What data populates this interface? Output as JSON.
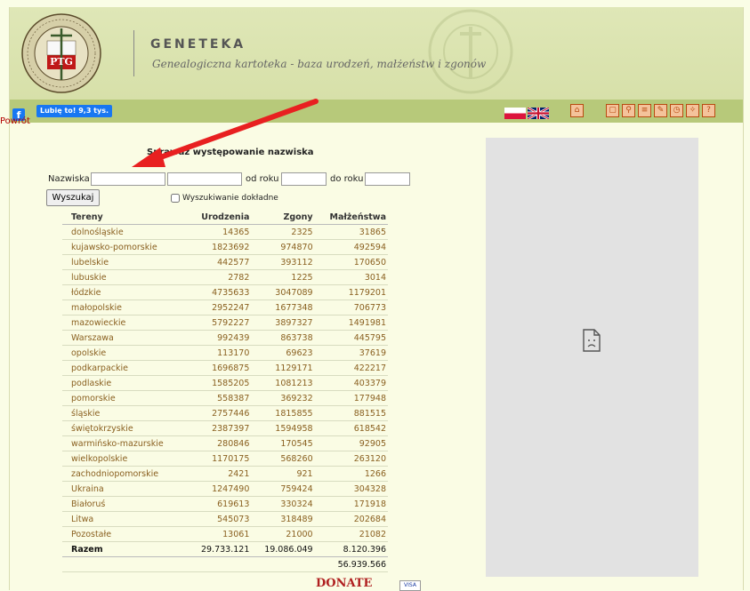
{
  "header": {
    "title": "GENETEKA",
    "subtitle": "Genealogiczna kartoteka - baza urodzeń, małżeństw i zgonów",
    "logo_text": "PTG"
  },
  "nav": {
    "fb_like_label": "Lubię to! 9,3 tys.",
    "flags": [
      "pl-flag",
      "uk-flag"
    ],
    "icons": [
      "home-icon",
      "book-icon",
      "search-icon",
      "list-icon",
      "edit-icon",
      "clock-icon",
      "tools-icon",
      "help-icon"
    ]
  },
  "back_link": "Powrót",
  "search": {
    "title": "Sprawdź występowanie nazwiska",
    "surname_label": "Nazwiska",
    "surname_value": "",
    "surname2_value": "",
    "from_label": "od roku",
    "from_value": "",
    "to_label": "do roku",
    "to_value": "",
    "button_label": "Wyszukaj",
    "exact_label": "Wyszukiwanie dokładne"
  },
  "table": {
    "headers": [
      "Tereny",
      "Urodzenia",
      "Zgony",
      "Małżeństwa"
    ],
    "rows": [
      [
        "dolnośląskie",
        "14365",
        "2325",
        "31865"
      ],
      [
        "kujawsko-pomorskie",
        "1823692",
        "974870",
        "492594"
      ],
      [
        "lubelskie",
        "442577",
        "393112",
        "170650"
      ],
      [
        "lubuskie",
        "2782",
        "1225",
        "3014"
      ],
      [
        "łódzkie",
        "4735633",
        "3047089",
        "1179201"
      ],
      [
        "małopolskie",
        "2952247",
        "1677348",
        "706773"
      ],
      [
        "mazowieckie",
        "5792227",
        "3897327",
        "1491981"
      ],
      [
        "Warszawa",
        "992439",
        "863738",
        "445795"
      ],
      [
        "opolskie",
        "113170",
        "69623",
        "37619"
      ],
      [
        "podkarpackie",
        "1696875",
        "1129171",
        "422217"
      ],
      [
        "podlaskie",
        "1585205",
        "1081213",
        "403379"
      ],
      [
        "pomorskie",
        "558387",
        "369232",
        "177948"
      ],
      [
        "śląskie",
        "2757446",
        "1815855",
        "881515"
      ],
      [
        "świętokrzyskie",
        "2387397",
        "1594958",
        "618542"
      ],
      [
        "warmińsko-mazurskie",
        "280846",
        "170545",
        "92905"
      ],
      [
        "wielkopolskie",
        "1170175",
        "568260",
        "263120"
      ],
      [
        "zachodniopomorskie",
        "2421",
        "921",
        "1266"
      ],
      [
        "Ukraina",
        "1247490",
        "759424",
        "304328"
      ],
      [
        "Białoruś",
        "619613",
        "330324",
        "171918"
      ],
      [
        "Litwa",
        "545073",
        "318489",
        "202684"
      ],
      [
        "Pozostałe",
        "13061",
        "21000",
        "21082"
      ]
    ],
    "total": [
      "Razem",
      "29.733.121",
      "19.086.049",
      "8.120.396"
    ],
    "grand_total": "56.939.566"
  },
  "donate_label": "DONATE",
  "donate_card": "VISA",
  "colors": {
    "header_bg": "#dfe7b7",
    "nav_bg": "#b7c97a",
    "arrow": "#e82020",
    "link": "#8a6020"
  }
}
